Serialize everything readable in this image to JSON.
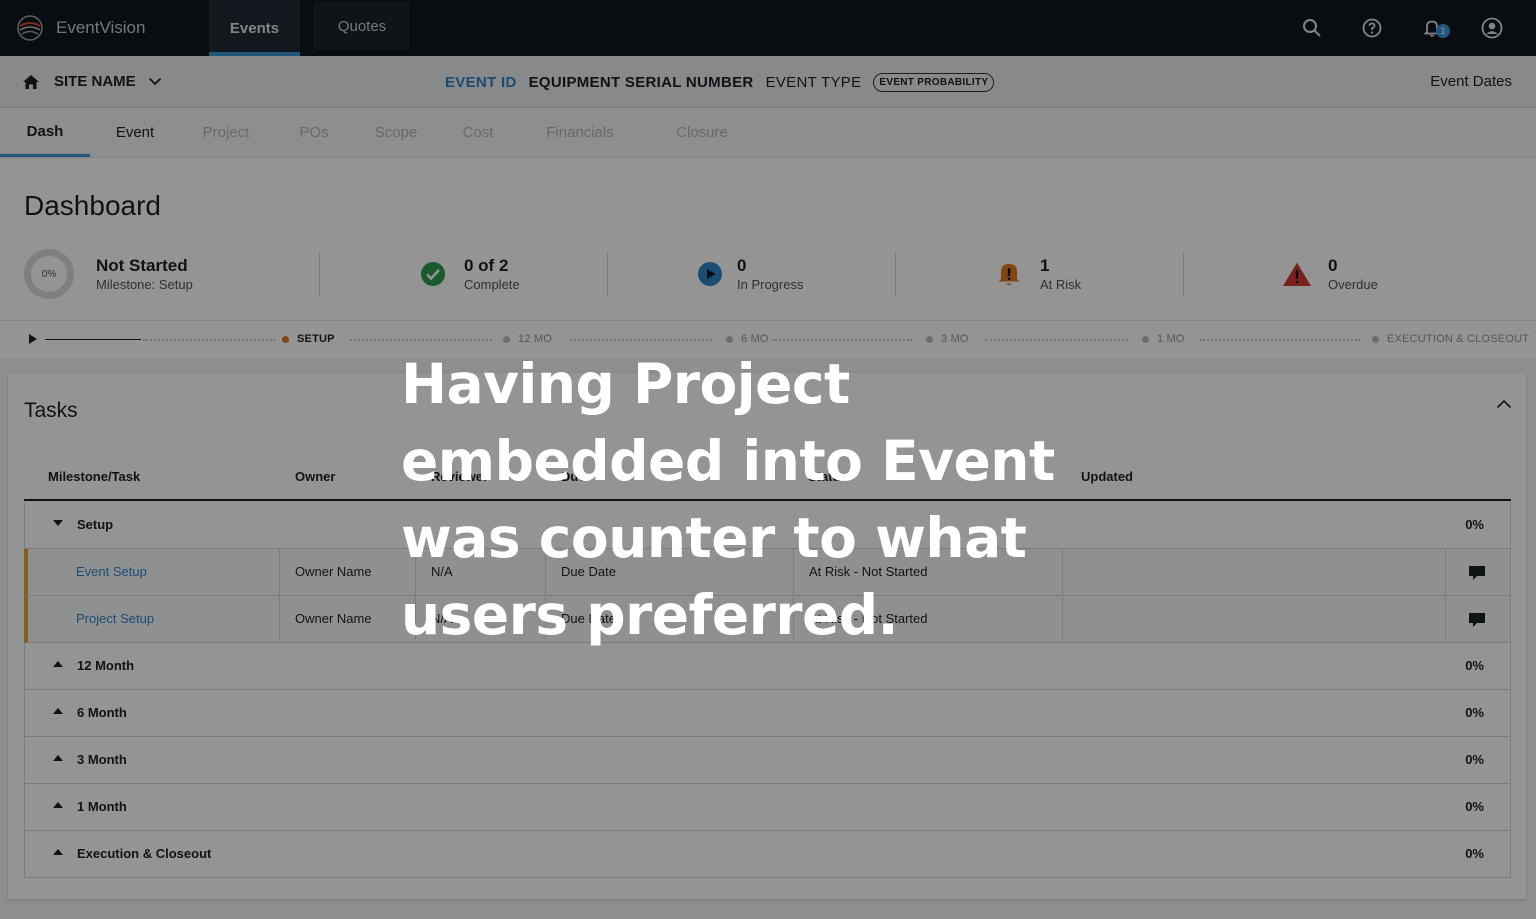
{
  "app": {
    "name": "EventVision",
    "top_tabs": [
      "Events",
      "Quotes"
    ],
    "notification_count": "1"
  },
  "context": {
    "site_name": "SITE NAME",
    "event_id": "EVENT ID",
    "equipment_serial": "EQUIPMENT SERIAL NUMBER",
    "event_type": "EVENT TYPE",
    "event_probability": "EVENT PROBABILITY",
    "event_dates": "Event Dates"
  },
  "subtabs": [
    "Dash",
    "Event",
    "Project",
    "POs",
    "Scope",
    "Cost",
    "Financials",
    "Closure"
  ],
  "dashboard": {
    "title": "Dashboard",
    "progress": {
      "percent_label": "0%",
      "status": "Not Started",
      "milestone": "Milestone: Setup"
    },
    "complete": {
      "value": "0 of 2",
      "label": "Complete"
    },
    "in_progress": {
      "value": "0",
      "label": "In Progress"
    },
    "at_risk": {
      "value": "1",
      "label": "At Risk"
    },
    "overdue": {
      "value": "0",
      "label": "Overdue"
    },
    "timeline": [
      "SETUP",
      "12 MO",
      "6 MO",
      "3 MO",
      "1 MO",
      "EXECUTION & CLOSEOUT"
    ]
  },
  "tasks": {
    "title": "Tasks",
    "columns": [
      "Milestone/Task",
      "Owner",
      "Reviewer",
      "Due",
      "Status",
      "Updated"
    ],
    "groups": [
      {
        "name": "Setup",
        "percent": "0%",
        "tasks": [
          {
            "name": "Event Setup",
            "owner": "Owner Name",
            "reviewer": "N/A",
            "due": "Due Date",
            "status": "At Risk - Not Started"
          },
          {
            "name": "Project Setup",
            "owner": "Owner Name",
            "reviewer": "N/A",
            "due": "Due Date",
            "status": "At Risk - Not Started"
          }
        ]
      },
      {
        "name": "12 Month",
        "percent": "0%"
      },
      {
        "name": "6 Month",
        "percent": "0%"
      },
      {
        "name": "3 Month",
        "percent": "0%"
      },
      {
        "name": "1 Month",
        "percent": "0%"
      },
      {
        "name": "Execution & Closeout",
        "percent": "0%"
      }
    ]
  },
  "caption": "Having Project embedded into Event was counter to what users preferred.",
  "colors": {
    "nav_bg": "#101820",
    "accent_blue": "#3b97d3",
    "complete_green": "#2e9c4d",
    "at_risk_orange": "#e07a1e",
    "overdue_red": "#d33a33"
  }
}
